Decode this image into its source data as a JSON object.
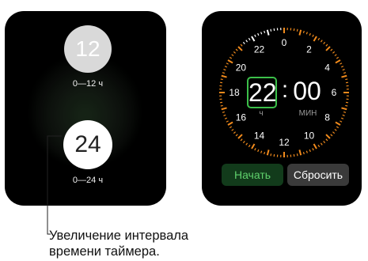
{
  "left_screen": {
    "option_12": {
      "value": "12",
      "label": "0—12 ч"
    },
    "option_24": {
      "value": "24",
      "label": "0—24 ч"
    }
  },
  "timer": {
    "dial_numbers": [
      "0",
      "2",
      "4",
      "6",
      "8",
      "10",
      "12",
      "14",
      "16",
      "18",
      "20",
      "22"
    ],
    "hours": "22",
    "separator": ":",
    "minutes": "00",
    "hours_unit": "ч",
    "minutes_unit": "МИН",
    "accent_color": "#f08a1c",
    "start_label": "Начать",
    "reset_label": "Сбросить"
  },
  "caption": {
    "line1": "Увеличение интервала",
    "line2": "времени таймера."
  }
}
